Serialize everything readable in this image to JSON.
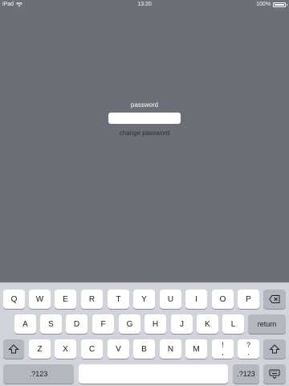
{
  "status_bar": {
    "carrier": "iPad",
    "time": "13:20",
    "battery_text": "100%",
    "battery_level": 1.0
  },
  "login": {
    "label": "password",
    "password_value": "",
    "link_text": "change password"
  },
  "keyboard": {
    "row1": [
      "Q",
      "W",
      "E",
      "R",
      "T",
      "Y",
      "U",
      "I",
      "O",
      "P"
    ],
    "row2": [
      "A",
      "S",
      "D",
      "F",
      "G",
      "H",
      "J",
      "K",
      "L"
    ],
    "row3": [
      "Z",
      "X",
      "C",
      "V",
      "B",
      "N",
      "M"
    ],
    "excl": {
      "top": "!",
      "bottom": ","
    },
    "quest": {
      "top": "?",
      "bottom": "."
    },
    "return_label": "return",
    "numbers_label": ".?123",
    "space_label": ""
  }
}
